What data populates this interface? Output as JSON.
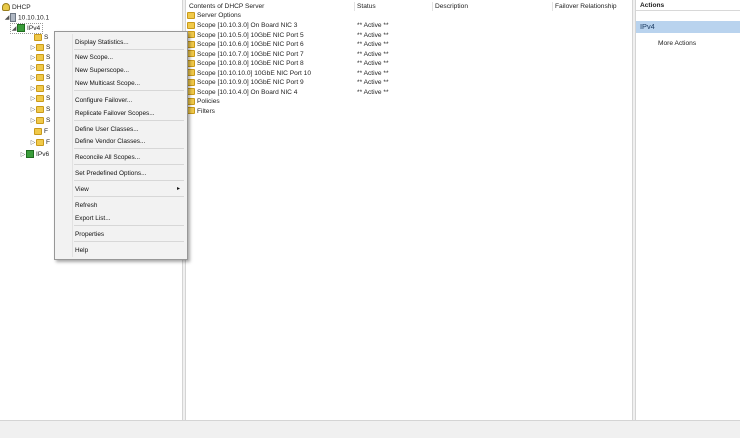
{
  "tree": {
    "root_label": "DHCP",
    "server_label": "10.10.10.1",
    "ipv4_label": "IPv4",
    "ipv6_label": "IPv6",
    "partial_child_labels": [
      "S",
      "S",
      "S",
      "S",
      "S",
      "S",
      "S",
      "S",
      "F",
      "F"
    ]
  },
  "list": {
    "columns": [
      "Contents of DHCP Server",
      "Status",
      "Description",
      "Failover Relationship"
    ],
    "rows": [
      {
        "name": "Server Options",
        "status": ""
      },
      {
        "name": "Scope [10.10.3.0] On Board NIC 3",
        "status": "** Active **"
      },
      {
        "name": "Scope [10.10.5.0] 10GbE NIC Port 5",
        "status": "** Active **"
      },
      {
        "name": "Scope [10.10.6.0] 10GbE NIC Port 6",
        "status": "** Active **"
      },
      {
        "name": "Scope [10.10.7.0] 10GbE NIC Port 7",
        "status": "** Active **"
      },
      {
        "name": "Scope [10.10.8.0] 10GbE NIC Port 8",
        "status": "** Active **"
      },
      {
        "name": "Scope [10.10.10.0] 10GbE NIC Port 10",
        "status": "** Active **"
      },
      {
        "name": "Scope [10.10.9.0] 10GbE NIC Port 9",
        "status": "** Active **"
      },
      {
        "name": "Scope [10.10.4.0] On Board NIC 4",
        "status": "** Active **"
      },
      {
        "name": "Policies",
        "status": ""
      },
      {
        "name": "Filters",
        "status": ""
      }
    ]
  },
  "actions": {
    "header": "Actions",
    "selected": "IPv4",
    "more": "More Actions"
  },
  "context_menu": {
    "items": [
      "Display Statistics...",
      "New Scope...",
      "New Superscope...",
      "New Multicast Scope...",
      "Configure Failover...",
      "Replicate Failover Scopes...",
      "Define User Classes...",
      "Define Vendor Classes...",
      "Reconcile All Scopes...",
      "Set Predefined Options...",
      "View",
      "Refresh",
      "Export List...",
      "Properties",
      "Help"
    ],
    "submenu_arrow": "▸"
  }
}
